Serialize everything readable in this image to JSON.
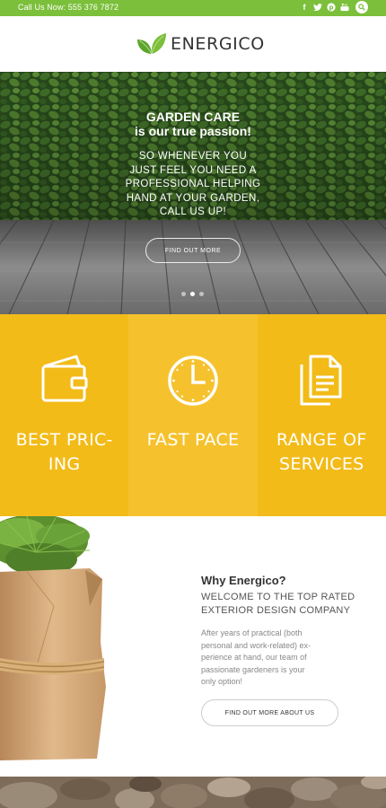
{
  "topbar": {
    "phone": "Call Us Now: 555 376 7872",
    "socials": [
      {
        "icon": "facebook-icon",
        "glyph": "f"
      },
      {
        "icon": "twitter-icon",
        "glyph": "t"
      },
      {
        "icon": "pinterest-icon",
        "glyph": "p"
      },
      {
        "icon": "youtube-icon",
        "glyph": "y"
      }
    ],
    "search_icon": "search-icon"
  },
  "header": {
    "logo_text": "ENERGICO",
    "logo_icon": "leaf-icon"
  },
  "hero": {
    "title_line1": "GARDEN CARE",
    "title_line2": "is our true passion!",
    "sub_lines": [
      "SO WHENEVER YOU",
      "JUST FEEL YOU NEED A",
      "PROFESSIONAL HELPING",
      "HAND AT YOUR GARDEN,",
      "CALL US UP!"
    ],
    "button_label": "FIND OUT MORE",
    "slides": 3,
    "active_slide": 1
  },
  "features": [
    {
      "line1": "BEST PRIC-",
      "line2": "ING",
      "icon": "wallet-icon",
      "bg": "#f2bb18"
    },
    {
      "line1": "FAST PACE",
      "line2": "",
      "icon": "clock-icon",
      "bg": "#f5c22e"
    },
    {
      "line1": "RANGE OF",
      "line2": "SERVICES",
      "icon": "documents-icon",
      "bg": "#f2bb18"
    }
  ],
  "about": {
    "title": "Why Energico?",
    "subtitle_line1": "WELCOME TO THE TOP RATED",
    "subtitle_line2": "EXTERIOR DESIGN COMPANY",
    "text_lines": [
      "After years of practical (both",
      "personal and work-related) ex-",
      "perience at hand, our team of",
      "passionate gardeners is your",
      "only option!"
    ],
    "button_label": "FIND OUT MORE ABOUT US"
  },
  "colors": {
    "accent_green": "#7bbf3a",
    "feature_yellow": "#f2bb18",
    "feature_yellow_light": "#f5c22e"
  }
}
